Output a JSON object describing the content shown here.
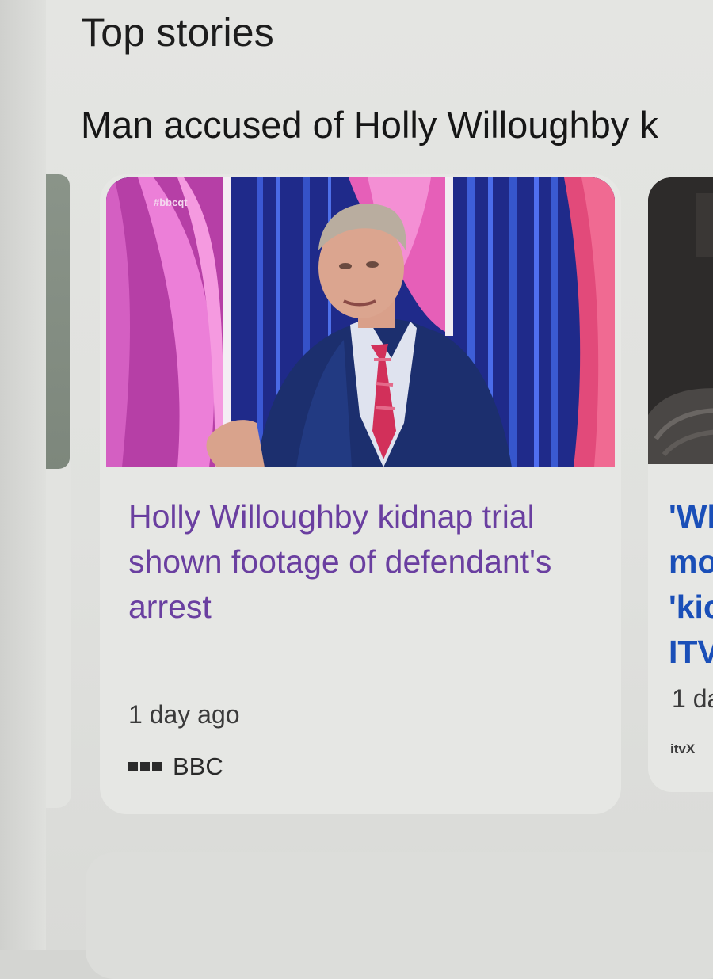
{
  "section": {
    "title": "Top stories"
  },
  "story": {
    "title": "Man accused of Holly Willoughby k"
  },
  "cards": [
    {
      "image_watermark": "#bbcqt",
      "headline": "Holly Willoughby kidnap trial shown footage of defendant's arrest",
      "time": "1 day ago",
      "source": "BBC",
      "source_logo_icon": "bbc-logo-icon"
    },
    {
      "headline_lines": [
        "'Wl",
        "mo",
        "'kic",
        "ITV"
      ],
      "time": "1 da",
      "source": "itvX"
    }
  ],
  "colors": {
    "visited_link": "#6a3fa0",
    "link": "#1a4fb8",
    "background": "#e1e2df"
  }
}
